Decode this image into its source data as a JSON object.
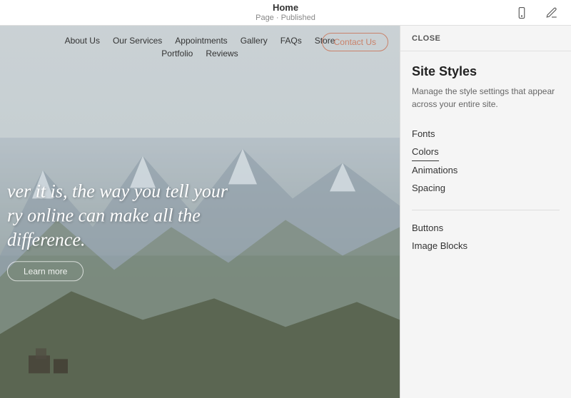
{
  "topbar": {
    "title": "Home",
    "subtitle": "Page · Published",
    "mobile_icon": "mobile-icon",
    "edit_icon": "edit-icon"
  },
  "nav": {
    "links": [
      "About Us",
      "Our Services",
      "Appointments",
      "Gallery",
      "FAQs",
      "Store"
    ],
    "second_links": [
      "Portfolio",
      "Reviews"
    ],
    "contact_btn": "Contact Us"
  },
  "hero": {
    "text_line1": "ver it is, the way you tell your",
    "text_line2": "ry online can make all the",
    "text_line3": "difference.",
    "learn_more": "Learn more"
  },
  "panel": {
    "close_label": "CLOSE",
    "title": "Site Styles",
    "description": "Manage the style settings that appear across your entire site.",
    "items_group1": [
      "Fonts",
      "Colors",
      "Animations",
      "Spacing"
    ],
    "items_group2": [
      "Buttons",
      "Image Blocks"
    ],
    "active_item": "Colors"
  }
}
